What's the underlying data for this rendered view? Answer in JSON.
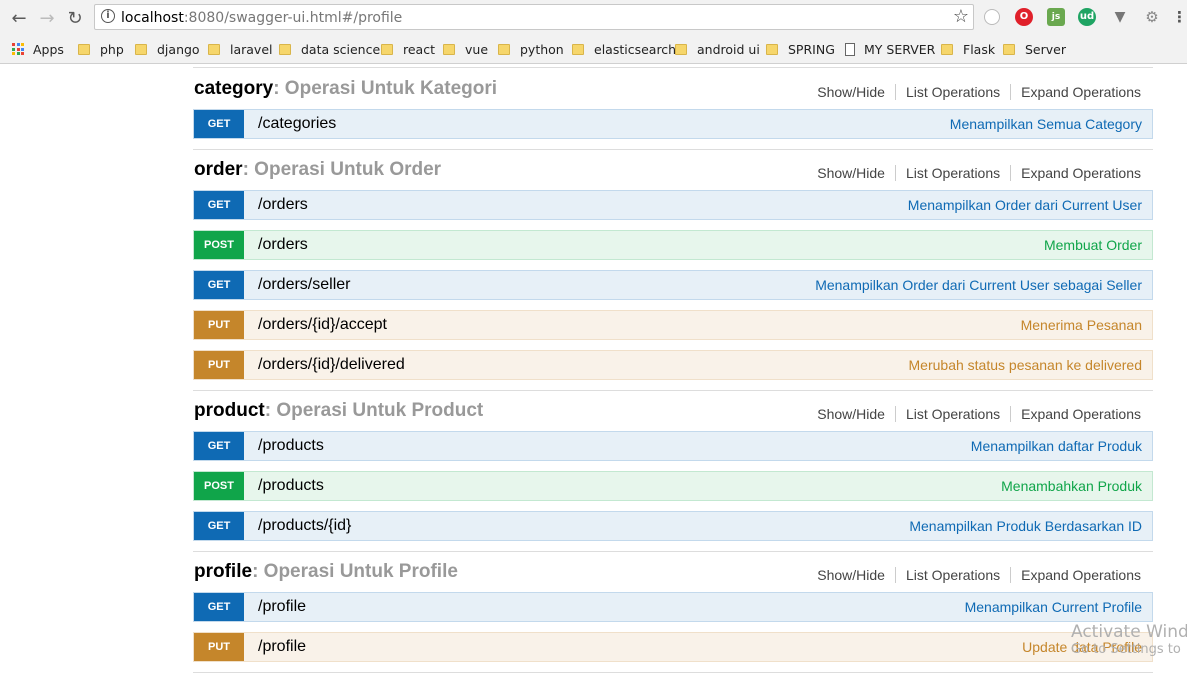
{
  "browser": {
    "url_host": "localhost",
    "url_rest": ":8080/swagger-ui.html#/profile",
    "bookmarks": [
      {
        "label": "Apps",
        "icon": "apps-grid-icon"
      },
      {
        "label": "php",
        "icon": "folder-icon"
      },
      {
        "label": "django",
        "icon": "folder-icon"
      },
      {
        "label": "laravel",
        "icon": "folder-icon"
      },
      {
        "label": "data science",
        "icon": "folder-icon"
      },
      {
        "label": "react",
        "icon": "folder-icon"
      },
      {
        "label": "vue",
        "icon": "folder-icon"
      },
      {
        "label": "python",
        "icon": "folder-icon"
      },
      {
        "label": "elasticsearch",
        "icon": "folder-icon"
      },
      {
        "label": "android ui",
        "icon": "folder-icon"
      },
      {
        "label": "SPRING",
        "icon": "folder-icon"
      },
      {
        "label": "MY SERVER",
        "icon": "page-icon"
      },
      {
        "label": "Flask",
        "icon": "folder-icon"
      },
      {
        "label": "Server",
        "icon": "folder-icon"
      }
    ],
    "extensions": [
      "ud"
    ]
  },
  "resource_options": [
    "Show/Hide",
    "List Operations",
    "Expand Operations"
  ],
  "resources": [
    {
      "name": "category",
      "description": ": Operasi Untuk Kategori",
      "operations": [
        {
          "method": "GET",
          "path": "/categories",
          "summary": "Menampilkan Semua Category"
        }
      ]
    },
    {
      "name": "order",
      "description": ": Operasi Untuk Order",
      "operations": [
        {
          "method": "GET",
          "path": "/orders",
          "summary": "Menampilkan Order dari Current User"
        },
        {
          "method": "POST",
          "path": "/orders",
          "summary": "Membuat Order"
        },
        {
          "method": "GET",
          "path": "/orders/seller",
          "summary": "Menampilkan Order dari Current User sebagai Seller"
        },
        {
          "method": "PUT",
          "path": "/orders/{id}/accept",
          "summary": "Menerima Pesanan"
        },
        {
          "method": "PUT",
          "path": "/orders/{id}/delivered",
          "summary": "Merubah status pesanan ke delivered"
        }
      ]
    },
    {
      "name": "product",
      "description": ": Operasi Untuk Product",
      "operations": [
        {
          "method": "GET",
          "path": "/products",
          "summary": "Menampilkan daftar Produk"
        },
        {
          "method": "POST",
          "path": "/products",
          "summary": "Menambahkan Produk"
        },
        {
          "method": "GET",
          "path": "/products/{id}",
          "summary": "Menampilkan Produk Berdasarkan ID"
        }
      ]
    },
    {
      "name": "profile",
      "description": ": Operasi Untuk Profile",
      "operations": [
        {
          "method": "GET",
          "path": "/profile",
          "summary": "Menampilkan Current Profile"
        },
        {
          "method": "PUT",
          "path": "/profile",
          "summary": "Update data Profile"
        }
      ]
    }
  ],
  "watermark": {
    "line1": "Activate Wind",
    "line2": "Go to Settings to"
  },
  "colors": {
    "get": "#0f6ab4",
    "post": "#10a54a",
    "put": "#c5862b"
  }
}
